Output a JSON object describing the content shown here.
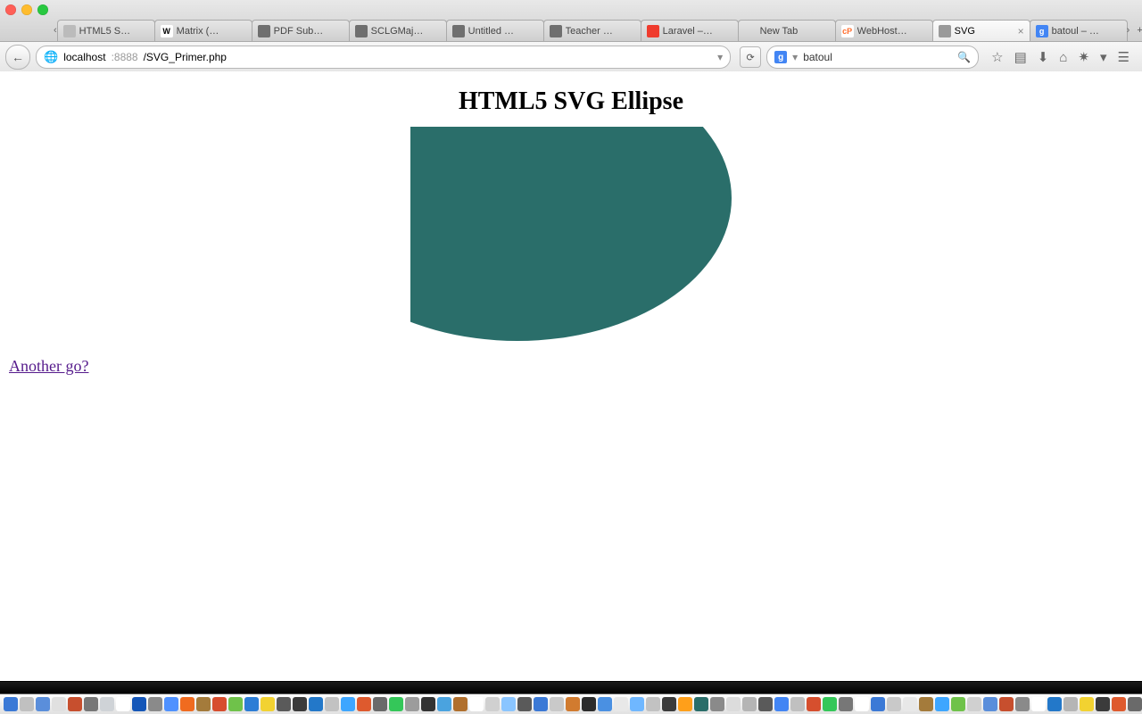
{
  "window": {
    "tabs": [
      {
        "label": "HTML5 S…",
        "favicon_text": "",
        "favicon_bg": "#bbbbbb"
      },
      {
        "label": "Matrix (…",
        "favicon_text": "W",
        "favicon_bg": "#ffffff",
        "favicon_fg": "#000"
      },
      {
        "label": "PDF Sub…",
        "favicon_text": "",
        "favicon_bg": "#6f6f6f"
      },
      {
        "label": "SCLGMaj…",
        "favicon_text": "",
        "favicon_bg": "#6f6f6f"
      },
      {
        "label": "Untitled …",
        "favicon_text": "",
        "favicon_bg": "#6f6f6f"
      },
      {
        "label": "Teacher …",
        "favicon_text": "",
        "favicon_bg": "#6f6f6f"
      },
      {
        "label": "Laravel –…",
        "favicon_text": "",
        "favicon_bg": "#ef3b2d"
      },
      {
        "label": "New Tab",
        "favicon_text": "",
        "favicon_bg": "transparent"
      },
      {
        "label": "WebHost…",
        "favicon_text": "cP",
        "favicon_bg": "#ffffff",
        "favicon_fg": "#ff6c2c"
      },
      {
        "label": "SVG",
        "favicon_text": "",
        "favicon_bg": "#9a9a9a",
        "active": true,
        "closable": true
      },
      {
        "label": "batoul – …",
        "favicon_text": "g",
        "favicon_bg": "#4285f4"
      }
    ],
    "tabnav_back": "‹",
    "tabnav_fwd": "›",
    "tabend_plus": "+",
    "tabend_menu": "▾",
    "tabend_full": "⤢"
  },
  "nav": {
    "back_glyph": "←",
    "globe_glyph": "🌐",
    "url_host": "localhost",
    "url_port": ":8888",
    "url_path": "/SVG_Primer.php",
    "dropdown_glyph": "▾",
    "reload_glyph": "⟳",
    "search_engine_glyph": "g",
    "search_value": "batoul",
    "search_mag": "🔍",
    "icons": {
      "star": "☆",
      "reader": "▤",
      "down": "⬇",
      "home": "⌂",
      "share": "✷",
      "share_drop": "▾",
      "menu": "☰"
    }
  },
  "page": {
    "title": "HTML5 SVG Ellipse",
    "ellipse_fill": "#2a6e6a",
    "link_text": "Another go?"
  },
  "dock_colors": [
    "#3b79d6",
    "#c0c0c0",
    "#5a8edb",
    "#e0e0e0",
    "#c74f2e",
    "#777",
    "#cfd3d7",
    "#ffffff",
    "#1456b8",
    "#8a8a8a",
    "#4f91ff",
    "#f06b1f",
    "#a47b3b",
    "#d74d2e",
    "#6fc24a",
    "#2c7dd6",
    "#f2d231",
    "#5a5a5a",
    "#3b3b3b",
    "#2378c9",
    "#c2c2c2",
    "#3ea6ff",
    "#de5a2e",
    "#6a6a6a",
    "#34c759",
    "#9c9c9c",
    "#333333",
    "#4aa3df",
    "#b06f2d",
    "#ffffff",
    "#d0d0d0",
    "#8ac5ff",
    "#5a5a5a",
    "#3b79d6",
    "#c9c9c9",
    "#d17b2f",
    "#2c2c2c",
    "#4a90e2",
    "#e8e8e8",
    "#6fb7ff",
    "#c2c2c2",
    "#3b3b3b",
    "#ff9f1a",
    "#2a6e6a",
    "#8a8a8a",
    "#dcdcdc",
    "#b5b5b5",
    "#5a5a5a",
    "#4285f4",
    "#c0c0c0",
    "#d64f2e",
    "#34c759",
    "#777777",
    "#ffffff",
    "#3b79d6",
    "#c9c9c9",
    "#e8e8e8",
    "#a47b3b",
    "#3ea6ff",
    "#6fc24a",
    "#d0d0d0",
    "#5a8edb",
    "#c74f2e",
    "#8a8a8a",
    "#ffffff",
    "#2378c9",
    "#b5b5b5",
    "#f2d231",
    "#3b3b3b",
    "#de5a2e",
    "#6a6a6a",
    "#4aa3df",
    "#c2c2c2",
    "#333333",
    "#ff9f1a",
    "#2a6e6a"
  ]
}
